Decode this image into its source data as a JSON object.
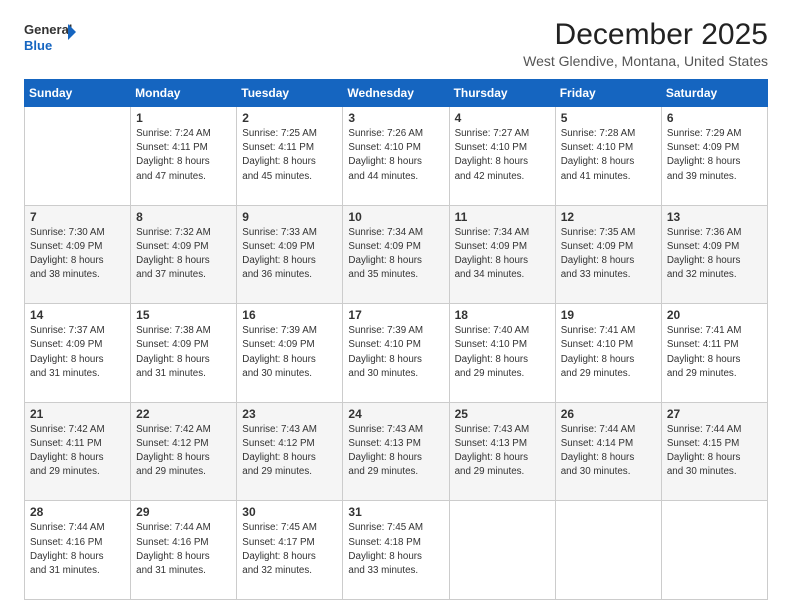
{
  "header": {
    "logo_line1": "General",
    "logo_line2": "Blue",
    "title": "December 2025",
    "subtitle": "West Glendive, Montana, United States"
  },
  "days_of_week": [
    "Sunday",
    "Monday",
    "Tuesday",
    "Wednesday",
    "Thursday",
    "Friday",
    "Saturday"
  ],
  "weeks": [
    [
      {
        "day": "",
        "info": ""
      },
      {
        "day": "1",
        "info": "Sunrise: 7:24 AM\nSunset: 4:11 PM\nDaylight: 8 hours\nand 47 minutes."
      },
      {
        "day": "2",
        "info": "Sunrise: 7:25 AM\nSunset: 4:11 PM\nDaylight: 8 hours\nand 45 minutes."
      },
      {
        "day": "3",
        "info": "Sunrise: 7:26 AM\nSunset: 4:10 PM\nDaylight: 8 hours\nand 44 minutes."
      },
      {
        "day": "4",
        "info": "Sunrise: 7:27 AM\nSunset: 4:10 PM\nDaylight: 8 hours\nand 42 minutes."
      },
      {
        "day": "5",
        "info": "Sunrise: 7:28 AM\nSunset: 4:10 PM\nDaylight: 8 hours\nand 41 minutes."
      },
      {
        "day": "6",
        "info": "Sunrise: 7:29 AM\nSunset: 4:09 PM\nDaylight: 8 hours\nand 39 minutes."
      }
    ],
    [
      {
        "day": "7",
        "info": "Sunrise: 7:30 AM\nSunset: 4:09 PM\nDaylight: 8 hours\nand 38 minutes."
      },
      {
        "day": "8",
        "info": "Sunrise: 7:32 AM\nSunset: 4:09 PM\nDaylight: 8 hours\nand 37 minutes."
      },
      {
        "day": "9",
        "info": "Sunrise: 7:33 AM\nSunset: 4:09 PM\nDaylight: 8 hours\nand 36 minutes."
      },
      {
        "day": "10",
        "info": "Sunrise: 7:34 AM\nSunset: 4:09 PM\nDaylight: 8 hours\nand 35 minutes."
      },
      {
        "day": "11",
        "info": "Sunrise: 7:34 AM\nSunset: 4:09 PM\nDaylight: 8 hours\nand 34 minutes."
      },
      {
        "day": "12",
        "info": "Sunrise: 7:35 AM\nSunset: 4:09 PM\nDaylight: 8 hours\nand 33 minutes."
      },
      {
        "day": "13",
        "info": "Sunrise: 7:36 AM\nSunset: 4:09 PM\nDaylight: 8 hours\nand 32 minutes."
      }
    ],
    [
      {
        "day": "14",
        "info": "Sunrise: 7:37 AM\nSunset: 4:09 PM\nDaylight: 8 hours\nand 31 minutes."
      },
      {
        "day": "15",
        "info": "Sunrise: 7:38 AM\nSunset: 4:09 PM\nDaylight: 8 hours\nand 31 minutes."
      },
      {
        "day": "16",
        "info": "Sunrise: 7:39 AM\nSunset: 4:09 PM\nDaylight: 8 hours\nand 30 minutes."
      },
      {
        "day": "17",
        "info": "Sunrise: 7:39 AM\nSunset: 4:10 PM\nDaylight: 8 hours\nand 30 minutes."
      },
      {
        "day": "18",
        "info": "Sunrise: 7:40 AM\nSunset: 4:10 PM\nDaylight: 8 hours\nand 29 minutes."
      },
      {
        "day": "19",
        "info": "Sunrise: 7:41 AM\nSunset: 4:10 PM\nDaylight: 8 hours\nand 29 minutes."
      },
      {
        "day": "20",
        "info": "Sunrise: 7:41 AM\nSunset: 4:11 PM\nDaylight: 8 hours\nand 29 minutes."
      }
    ],
    [
      {
        "day": "21",
        "info": "Sunrise: 7:42 AM\nSunset: 4:11 PM\nDaylight: 8 hours\nand 29 minutes."
      },
      {
        "day": "22",
        "info": "Sunrise: 7:42 AM\nSunset: 4:12 PM\nDaylight: 8 hours\nand 29 minutes."
      },
      {
        "day": "23",
        "info": "Sunrise: 7:43 AM\nSunset: 4:12 PM\nDaylight: 8 hours\nand 29 minutes."
      },
      {
        "day": "24",
        "info": "Sunrise: 7:43 AM\nSunset: 4:13 PM\nDaylight: 8 hours\nand 29 minutes."
      },
      {
        "day": "25",
        "info": "Sunrise: 7:43 AM\nSunset: 4:13 PM\nDaylight: 8 hours\nand 29 minutes."
      },
      {
        "day": "26",
        "info": "Sunrise: 7:44 AM\nSunset: 4:14 PM\nDaylight: 8 hours\nand 30 minutes."
      },
      {
        "day": "27",
        "info": "Sunrise: 7:44 AM\nSunset: 4:15 PM\nDaylight: 8 hours\nand 30 minutes."
      }
    ],
    [
      {
        "day": "28",
        "info": "Sunrise: 7:44 AM\nSunset: 4:16 PM\nDaylight: 8 hours\nand 31 minutes."
      },
      {
        "day": "29",
        "info": "Sunrise: 7:44 AM\nSunset: 4:16 PM\nDaylight: 8 hours\nand 31 minutes."
      },
      {
        "day": "30",
        "info": "Sunrise: 7:45 AM\nSunset: 4:17 PM\nDaylight: 8 hours\nand 32 minutes."
      },
      {
        "day": "31",
        "info": "Sunrise: 7:45 AM\nSunset: 4:18 PM\nDaylight: 8 hours\nand 33 minutes."
      },
      {
        "day": "",
        "info": ""
      },
      {
        "day": "",
        "info": ""
      },
      {
        "day": "",
        "info": ""
      }
    ]
  ]
}
